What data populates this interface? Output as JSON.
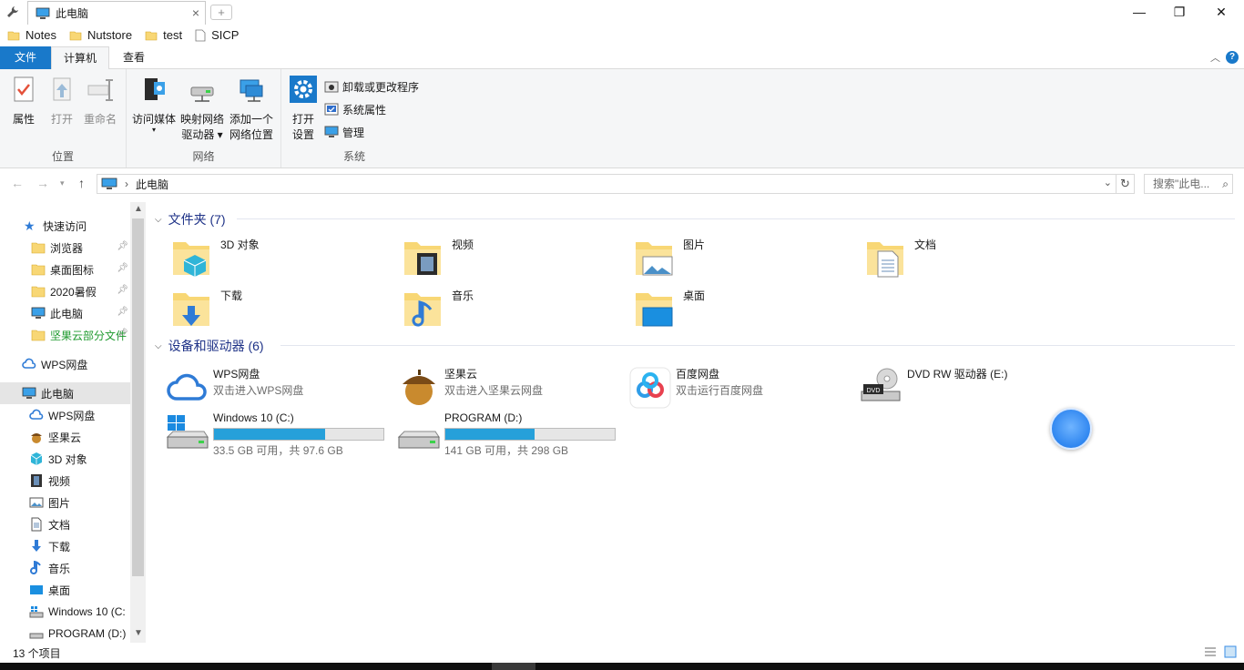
{
  "window": {
    "tab_title": "此电脑",
    "tab_close": "×",
    "new_tab": "+",
    "minimize": "—",
    "restore": "❐",
    "close": "✕"
  },
  "bookmarks": [
    "Notes",
    "Nutstore",
    "test",
    "SICP"
  ],
  "ribbon_tabs": {
    "file": "文件",
    "computer": "计算机",
    "view": "查看"
  },
  "ribbon": {
    "location": {
      "label": "位置",
      "properties": "属性",
      "open": "打开",
      "rename": "重命名"
    },
    "network": {
      "label": "网络",
      "media": "访问媒体",
      "map_drive_1": "映射网络",
      "map_drive_2": "驱动器",
      "add_location_1": "添加一个",
      "add_location_2": "网络位置"
    },
    "system": {
      "label": "系统",
      "open_settings_1": "打开",
      "open_settings_2": "设置",
      "uninstall": "卸载或更改程序",
      "sys_props": "系统属性",
      "manage": "管理"
    }
  },
  "address": {
    "path": "此电脑",
    "search_placeholder": "搜索\"此电..."
  },
  "sidebar": {
    "quick_access": "快速访问",
    "quick_items": [
      "浏览器",
      "桌面图标",
      "2020暑假",
      "此电脑",
      "坚果云部分文件"
    ],
    "wps": "WPS网盘",
    "this_pc": "此电脑",
    "pc_items": [
      "WPS网盘",
      "坚果云",
      "3D 对象",
      "视频",
      "图片",
      "文档",
      "下载",
      "音乐",
      "桌面",
      "Windows 10 (C:",
      "PROGRAM (D:)"
    ]
  },
  "main": {
    "folders_header": "文件夹 (7)",
    "folders": [
      "3D 对象",
      "视频",
      "图片",
      "文档",
      "下载",
      "音乐",
      "桌面"
    ],
    "devices_header": "设备和驱动器 (6)",
    "devices": [
      {
        "name": "WPS网盘",
        "sub": "双击进入WPS网盘"
      },
      {
        "name": "坚果云",
        "sub": "双击进入坚果云网盘"
      },
      {
        "name": "百度网盘",
        "sub": "双击运行百度网盘"
      },
      {
        "name": "DVD RW 驱动器 (E:)",
        "sub": ""
      }
    ],
    "drives": [
      {
        "name": "Windows 10 (C:)",
        "info": "33.5 GB 可用，共 97.6 GB",
        "used_fraction": 0.657
      },
      {
        "name": "PROGRAM (D:)",
        "info": "141 GB 可用，共 298 GB",
        "used_fraction": 0.527
      }
    ]
  },
  "status": {
    "count": "13 个项目"
  },
  "colors": {
    "accent": "#1979ca",
    "bar_fill": "#26a0da",
    "section_header": "#1e3287"
  }
}
